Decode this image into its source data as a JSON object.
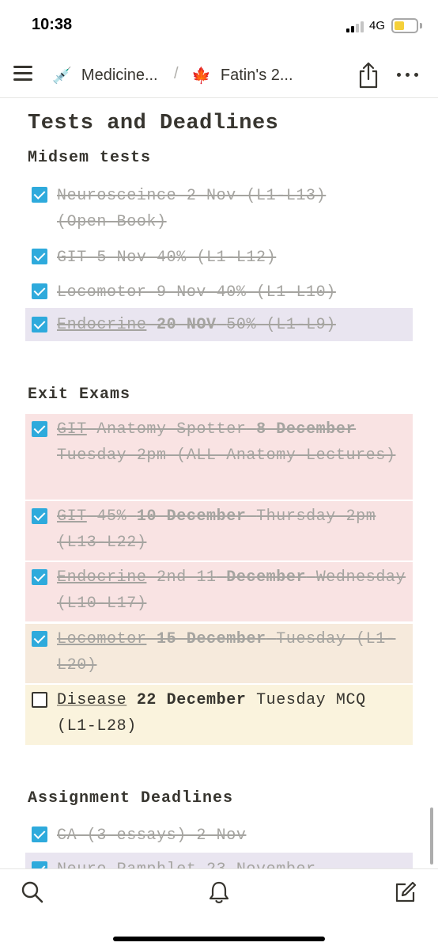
{
  "status": {
    "time": "10:38",
    "network": "4G"
  },
  "colors": {
    "accent_checkbox": "#2eaadc",
    "bg_purple": "#e9e5f0",
    "bg_red": "#f9e3e3",
    "bg_orange": "#f6eadc",
    "bg_yellow": "#faf3dd",
    "battery": "#f5d039"
  },
  "nav": {
    "menu_icon": "hamburger-icon",
    "crumb1": {
      "emoji": "💉",
      "label": "Medicine..."
    },
    "separator": "/",
    "crumb2": {
      "emoji": "🍁",
      "label": "Fatin's 2..."
    },
    "share_icon": "share-icon",
    "more_icon": "more-icon"
  },
  "page": {
    "title": "Tests and Deadlines",
    "sections": [
      {
        "heading": "Midsem tests",
        "items": [
          {
            "checked": true,
            "bg": "",
            "lines": [
              "Neurosceince 2 Nov (L1-L13)",
              "(Open Book)"
            ]
          },
          {
            "checked": true,
            "bg": "",
            "lines": [
              "GIT 5 Nov 40% (L1-L12)"
            ]
          },
          {
            "checked": true,
            "bg": "",
            "lines": [
              "Locomotor 9 Nov 40% (L1-L10)"
            ]
          },
          {
            "checked": true,
            "bg": "purple",
            "u": "Endocrine",
            "b": "20 NOV",
            "rest": "50% (L1-L9)"
          }
        ]
      },
      {
        "heading": "Exit Exams",
        "items": [
          {
            "checked": true,
            "bg": "red",
            "u": "GIT",
            "pre": "Anatomy Spotter",
            "b": "8 December",
            "rest": "Tuesday 2pm (ALL Anatomy Lectures)"
          },
          {
            "checked": true,
            "bg": "red",
            "u": "GIT",
            "pre": "45%",
            "b": "10 December",
            "rest": "Thursday 2pm (L13-L22)"
          },
          {
            "checked": true,
            "bg": "red",
            "u": "Endocrine",
            "pre": "2nd 11",
            "b": "December",
            "rest": "Wednesday (L10-L17)"
          },
          {
            "checked": true,
            "bg": "orange",
            "u": "Locomotor",
            "b": "15 December",
            "rest": "Tuesday (L1-L20)"
          },
          {
            "checked": false,
            "bg": "yellow",
            "u": "Disease",
            "b": "22 December",
            "rest": "Tuesday MCQ (L1-L28)"
          }
        ]
      },
      {
        "heading": "Assignment Deadlines",
        "items": [
          {
            "checked": true,
            "bg": "",
            "lines": [
              "CA (3 essays) 2 Nov"
            ]
          },
          {
            "checked": true,
            "bg": "purple",
            "lines": [
              "Neuro Pamphlet 23 November"
            ]
          }
        ]
      }
    ]
  },
  "tabbar": {
    "icons": [
      "search-icon",
      "bell-icon",
      "compose-icon"
    ]
  }
}
